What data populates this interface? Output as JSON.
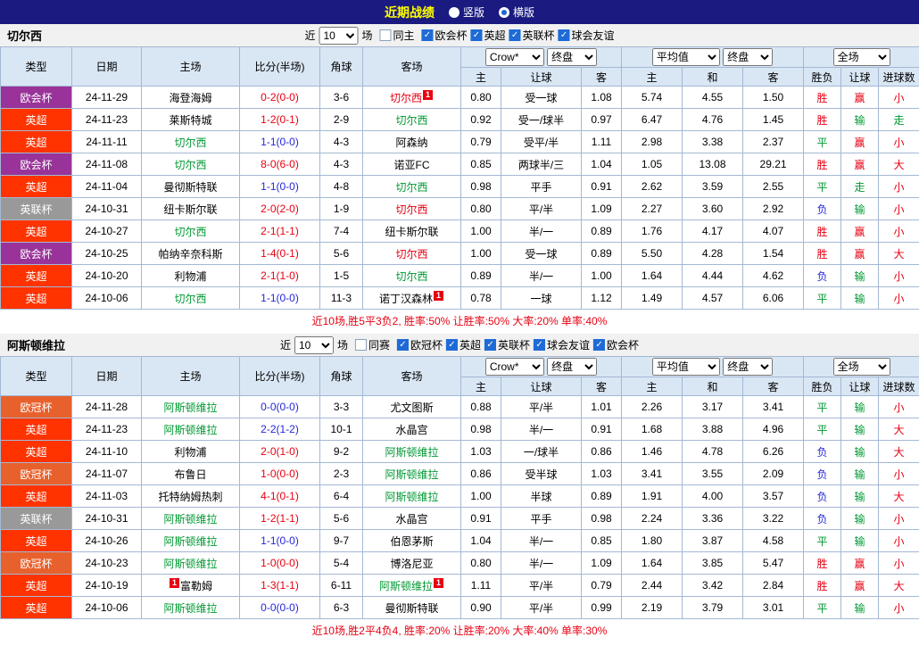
{
  "topbar": {
    "title": "近期战绩",
    "options": [
      {
        "label": "竖版",
        "selected": false
      },
      {
        "label": "横版",
        "selected": true
      }
    ]
  },
  "table_header": {
    "type": "类型",
    "date": "日期",
    "home": "主场",
    "score": "比分(半场)",
    "corner": "角球",
    "away": "客场",
    "odds_source": "Crow*",
    "stage": "终盘",
    "average": "平均值",
    "fulltime": "全场",
    "home_short": "主",
    "away_short": "客",
    "draw_short": "和",
    "handicap": "让球",
    "result": "胜负",
    "goals": "进球数"
  },
  "sections": [
    {
      "title": "切尔西",
      "filter": {
        "near_label": "近",
        "count": "10",
        "games_label": "场",
        "same_label": "同主",
        "same_checked": false,
        "competitions": [
          {
            "label": "欧会杯",
            "checked": true
          },
          {
            "label": "英超",
            "checked": true
          },
          {
            "label": "英联杯",
            "checked": true
          },
          {
            "label": "球会友谊",
            "checked": true
          }
        ]
      },
      "rows": [
        {
          "type": "欧会杯",
          "type_color": "#993399",
          "date": "24-11-29",
          "home": "海登海姆",
          "home_color": "#000000",
          "home_card": "",
          "score": "0-2(0-0)",
          "score_color": "#e60012",
          "corner": "3-6",
          "away": "切尔西",
          "away_color": "#e60012",
          "away_card": "1",
          "odds": [
            "0.80",
            "受一球",
            "1.08"
          ],
          "avg": [
            "5.74",
            "4.55",
            "1.50"
          ],
          "result": {
            "text": "胜",
            "color": "#e60012"
          },
          "handicap": {
            "text": "赢",
            "color": "#e60012"
          },
          "goals": {
            "text": "小",
            "color": "#e60012"
          }
        },
        {
          "type": "英超",
          "type_color": "#ff3300",
          "date": "24-11-23",
          "home": "莱斯特城",
          "home_color": "#000000",
          "home_card": "",
          "score": "1-2(0-1)",
          "score_color": "#e60012",
          "corner": "2-9",
          "away": "切尔西",
          "away_color": "#009933",
          "away_card": "",
          "odds": [
            "0.92",
            "受一/球半",
            "0.97"
          ],
          "avg": [
            "6.47",
            "4.76",
            "1.45"
          ],
          "result": {
            "text": "胜",
            "color": "#e60012"
          },
          "handicap": {
            "text": "输",
            "color": "#009933"
          },
          "goals": {
            "text": "走",
            "color": "#009933"
          }
        },
        {
          "type": "英超",
          "type_color": "#ff3300",
          "date": "24-11-11",
          "home": "切尔西",
          "home_color": "#009933",
          "home_card": "",
          "score": "1-1(0-0)",
          "score_color": "#2626d9",
          "corner": "4-3",
          "away": "阿森纳",
          "away_color": "#000000",
          "away_card": "",
          "odds": [
            "0.79",
            "受平/半",
            "1.11"
          ],
          "avg": [
            "2.98",
            "3.38",
            "2.37"
          ],
          "result": {
            "text": "平",
            "color": "#009933"
          },
          "handicap": {
            "text": "赢",
            "color": "#e60012"
          },
          "goals": {
            "text": "小",
            "color": "#e60012"
          }
        },
        {
          "type": "欧会杯",
          "type_color": "#993399",
          "date": "24-11-08",
          "home": "切尔西",
          "home_color": "#009933",
          "home_card": "",
          "score": "8-0(6-0)",
          "score_color": "#e60012",
          "corner": "4-3",
          "away": "诺亚FC",
          "away_color": "#000000",
          "away_card": "",
          "odds": [
            "0.85",
            "两球半/三",
            "1.04"
          ],
          "avg": [
            "1.05",
            "13.08",
            "29.21"
          ],
          "result": {
            "text": "胜",
            "color": "#e60012"
          },
          "handicap": {
            "text": "赢",
            "color": "#e60012"
          },
          "goals": {
            "text": "大",
            "color": "#e60012"
          }
        },
        {
          "type": "英超",
          "type_color": "#ff3300",
          "date": "24-11-04",
          "home": "曼彻斯特联",
          "home_color": "#000000",
          "home_card": "",
          "score": "1-1(0-0)",
          "score_color": "#2626d9",
          "corner": "4-8",
          "away": "切尔西",
          "away_color": "#009933",
          "away_card": "",
          "odds": [
            "0.98",
            "平手",
            "0.91"
          ],
          "avg": [
            "2.62",
            "3.59",
            "2.55"
          ],
          "result": {
            "text": "平",
            "color": "#009933"
          },
          "handicap": {
            "text": "走",
            "color": "#009933"
          },
          "goals": {
            "text": "小",
            "color": "#e60012"
          }
        },
        {
          "type": "英联杯",
          "type_color": "#999999",
          "date": "24-10-31",
          "home": "纽卡斯尔联",
          "home_color": "#000000",
          "home_card": "",
          "score": "2-0(2-0)",
          "score_color": "#e60012",
          "corner": "1-9",
          "away": "切尔西",
          "away_color": "#e60012",
          "away_card": "",
          "odds": [
            "0.80",
            "平/半",
            "1.09"
          ],
          "avg": [
            "2.27",
            "3.60",
            "2.92"
          ],
          "result": {
            "text": "负",
            "color": "#2626d9"
          },
          "handicap": {
            "text": "输",
            "color": "#009933"
          },
          "goals": {
            "text": "小",
            "color": "#e60012"
          }
        },
        {
          "type": "英超",
          "type_color": "#ff3300",
          "date": "24-10-27",
          "home": "切尔西",
          "home_color": "#009933",
          "home_card": "",
          "score": "2-1(1-1)",
          "score_color": "#e60012",
          "corner": "7-4",
          "away": "纽卡斯尔联",
          "away_color": "#000000",
          "away_card": "",
          "odds": [
            "1.00",
            "半/一",
            "0.89"
          ],
          "avg": [
            "1.76",
            "4.17",
            "4.07"
          ],
          "result": {
            "text": "胜",
            "color": "#e60012"
          },
          "handicap": {
            "text": "赢",
            "color": "#e60012"
          },
          "goals": {
            "text": "小",
            "color": "#e60012"
          }
        },
        {
          "type": "欧会杯",
          "type_color": "#993399",
          "date": "24-10-25",
          "home": "帕纳辛奈科斯",
          "home_color": "#000000",
          "home_card": "",
          "score": "1-4(0-1)",
          "score_color": "#e60012",
          "corner": "5-6",
          "away": "切尔西",
          "away_color": "#e60012",
          "away_card": "",
          "odds": [
            "1.00",
            "受一球",
            "0.89"
          ],
          "avg": [
            "5.50",
            "4.28",
            "1.54"
          ],
          "result": {
            "text": "胜",
            "color": "#e60012"
          },
          "handicap": {
            "text": "赢",
            "color": "#e60012"
          },
          "goals": {
            "text": "大",
            "color": "#e60012"
          }
        },
        {
          "type": "英超",
          "type_color": "#ff3300",
          "date": "24-10-20",
          "home": "利物浦",
          "home_color": "#000000",
          "home_card": "",
          "score": "2-1(1-0)",
          "score_color": "#e60012",
          "corner": "1-5",
          "away": "切尔西",
          "away_color": "#009933",
          "away_card": "",
          "odds": [
            "0.89",
            "半/一",
            "1.00"
          ],
          "avg": [
            "1.64",
            "4.44",
            "4.62"
          ],
          "result": {
            "text": "负",
            "color": "#2626d9"
          },
          "handicap": {
            "text": "输",
            "color": "#009933"
          },
          "goals": {
            "text": "小",
            "color": "#e60012"
          }
        },
        {
          "type": "英超",
          "type_color": "#ff3300",
          "date": "24-10-06",
          "home": "切尔西",
          "home_color": "#009933",
          "home_card": "",
          "score": "1-1(0-0)",
          "score_color": "#2626d9",
          "corner": "11-3",
          "away": "诺丁汉森林",
          "away_color": "#000000",
          "away_card": "1",
          "odds": [
            "0.78",
            "一球",
            "1.12"
          ],
          "avg": [
            "1.49",
            "4.57",
            "6.06"
          ],
          "result": {
            "text": "平",
            "color": "#009933"
          },
          "handicap": {
            "text": "输",
            "color": "#009933"
          },
          "goals": {
            "text": "小",
            "color": "#e60012"
          }
        }
      ],
      "summary": "近10场,胜5平3负2, 胜率:50% 让胜率:50% 大率:20% 单率:40%"
    },
    {
      "title": "阿斯顿维拉",
      "filter": {
        "near_label": "近",
        "count": "10",
        "games_label": "场",
        "same_label": "同赛",
        "same_checked": false,
        "competitions": [
          {
            "label": "欧冠杯",
            "checked": true
          },
          {
            "label": "英超",
            "checked": true
          },
          {
            "label": "英联杯",
            "checked": true
          },
          {
            "label": "球会友谊",
            "checked": true
          },
          {
            "label": "欧会杯",
            "checked": true
          }
        ]
      },
      "rows": [
        {
          "type": "欧冠杯",
          "type_color": "#e8612c",
          "date": "24-11-28",
          "home": "阿斯顿维拉",
          "home_color": "#009933",
          "home_card": "",
          "score": "0-0(0-0)",
          "score_color": "#2626d9",
          "corner": "3-3",
          "away": "尤文图斯",
          "away_color": "#000000",
          "away_card": "",
          "odds": [
            "0.88",
            "平/半",
            "1.01"
          ],
          "avg": [
            "2.26",
            "3.17",
            "3.41"
          ],
          "result": {
            "text": "平",
            "color": "#009933"
          },
          "handicap": {
            "text": "输",
            "color": "#009933"
          },
          "goals": {
            "text": "小",
            "color": "#e60012"
          }
        },
        {
          "type": "英超",
          "type_color": "#ff3300",
          "date": "24-11-23",
          "home": "阿斯顿维拉",
          "home_color": "#009933",
          "home_card": "",
          "score": "2-2(1-2)",
          "score_color": "#2626d9",
          "corner": "10-1",
          "away": "水晶宫",
          "away_color": "#000000",
          "away_card": "",
          "odds": [
            "0.98",
            "半/一",
            "0.91"
          ],
          "avg": [
            "1.68",
            "3.88",
            "4.96"
          ],
          "result": {
            "text": "平",
            "color": "#009933"
          },
          "handicap": {
            "text": "输",
            "color": "#009933"
          },
          "goals": {
            "text": "大",
            "color": "#e60012"
          }
        },
        {
          "type": "英超",
          "type_color": "#ff3300",
          "date": "24-11-10",
          "home": "利物浦",
          "home_color": "#000000",
          "home_card": "",
          "score": "2-0(1-0)",
          "score_color": "#e60012",
          "corner": "9-2",
          "away": "阿斯顿维拉",
          "away_color": "#009933",
          "away_card": "",
          "odds": [
            "1.03",
            "一/球半",
            "0.86"
          ],
          "avg": [
            "1.46",
            "4.78",
            "6.26"
          ],
          "result": {
            "text": "负",
            "color": "#2626d9"
          },
          "handicap": {
            "text": "输",
            "color": "#009933"
          },
          "goals": {
            "text": "大",
            "color": "#e60012"
          }
        },
        {
          "type": "欧冠杯",
          "type_color": "#e8612c",
          "date": "24-11-07",
          "home": "布鲁日",
          "home_color": "#000000",
          "home_card": "",
          "score": "1-0(0-0)",
          "score_color": "#e60012",
          "corner": "2-3",
          "away": "阿斯顿维拉",
          "away_color": "#009933",
          "away_card": "",
          "odds": [
            "0.86",
            "受半球",
            "1.03"
          ],
          "avg": [
            "3.41",
            "3.55",
            "2.09"
          ],
          "result": {
            "text": "负",
            "color": "#2626d9"
          },
          "handicap": {
            "text": "输",
            "color": "#009933"
          },
          "goals": {
            "text": "小",
            "color": "#e60012"
          }
        },
        {
          "type": "英超",
          "type_color": "#ff3300",
          "date": "24-11-03",
          "home": "托特纳姆热刺",
          "home_color": "#000000",
          "home_card": "",
          "score": "4-1(0-1)",
          "score_color": "#e60012",
          "corner": "6-4",
          "away": "阿斯顿维拉",
          "away_color": "#009933",
          "away_card": "",
          "odds": [
            "1.00",
            "半球",
            "0.89"
          ],
          "avg": [
            "1.91",
            "4.00",
            "3.57"
          ],
          "result": {
            "text": "负",
            "color": "#2626d9"
          },
          "handicap": {
            "text": "输",
            "color": "#009933"
          },
          "goals": {
            "text": "大",
            "color": "#e60012"
          }
        },
        {
          "type": "英联杯",
          "type_color": "#999999",
          "date": "24-10-31",
          "home": "阿斯顿维拉",
          "home_color": "#009933",
          "home_card": "",
          "score": "1-2(1-1)",
          "score_color": "#e60012",
          "corner": "5-6",
          "away": "水晶宫",
          "away_color": "#000000",
          "away_card": "",
          "odds": [
            "0.91",
            "平手",
            "0.98"
          ],
          "avg": [
            "2.24",
            "3.36",
            "3.22"
          ],
          "result": {
            "text": "负",
            "color": "#2626d9"
          },
          "handicap": {
            "text": "输",
            "color": "#009933"
          },
          "goals": {
            "text": "小",
            "color": "#e60012"
          }
        },
        {
          "type": "英超",
          "type_color": "#ff3300",
          "date": "24-10-26",
          "home": "阿斯顿维拉",
          "home_color": "#009933",
          "home_card": "",
          "score": "1-1(0-0)",
          "score_color": "#2626d9",
          "corner": "9-7",
          "away": "伯恩茅斯",
          "away_color": "#000000",
          "away_card": "",
          "odds": [
            "1.04",
            "半/一",
            "0.85"
          ],
          "avg": [
            "1.80",
            "3.87",
            "4.58"
          ],
          "result": {
            "text": "平",
            "color": "#009933"
          },
          "handicap": {
            "text": "输",
            "color": "#009933"
          },
          "goals": {
            "text": "小",
            "color": "#e60012"
          }
        },
        {
          "type": "欧冠杯",
          "type_color": "#e8612c",
          "date": "24-10-23",
          "home": "阿斯顿维拉",
          "home_color": "#009933",
          "home_card": "",
          "score": "1-0(0-0)",
          "score_color": "#e60012",
          "corner": "5-4",
          "away": "博洛尼亚",
          "away_color": "#000000",
          "away_card": "",
          "odds": [
            "0.80",
            "半/一",
            "1.09"
          ],
          "avg": [
            "1.64",
            "3.85",
            "5.47"
          ],
          "result": {
            "text": "胜",
            "color": "#e60012"
          },
          "handicap": {
            "text": "赢",
            "color": "#e60012"
          },
          "goals": {
            "text": "小",
            "color": "#e60012"
          }
        },
        {
          "type": "英超",
          "type_color": "#ff3300",
          "date": "24-10-19",
          "home": "富勒姆",
          "home_color": "#000000",
          "home_card": "1",
          "score": "1-3(1-1)",
          "score_color": "#e60012",
          "corner": "6-11",
          "away": "阿斯顿维拉",
          "away_color": "#009933",
          "away_card": "1",
          "odds": [
            "1.11",
            "平/半",
            "0.79"
          ],
          "avg": [
            "2.44",
            "3.42",
            "2.84"
          ],
          "result": {
            "text": "胜",
            "color": "#e60012"
          },
          "handicap": {
            "text": "赢",
            "color": "#e60012"
          },
          "goals": {
            "text": "大",
            "color": "#e60012"
          }
        },
        {
          "type": "英超",
          "type_color": "#ff3300",
          "date": "24-10-06",
          "home": "阿斯顿维拉",
          "home_color": "#009933",
          "home_card": "",
          "score": "0-0(0-0)",
          "score_color": "#2626d9",
          "corner": "6-3",
          "away": "曼彻斯特联",
          "away_color": "#000000",
          "away_card": "",
          "odds": [
            "0.90",
            "平/半",
            "0.99"
          ],
          "avg": [
            "2.19",
            "3.79",
            "3.01"
          ],
          "result": {
            "text": "平",
            "color": "#009933"
          },
          "handicap": {
            "text": "输",
            "color": "#009933"
          },
          "goals": {
            "text": "小",
            "color": "#e60012"
          }
        }
      ],
      "summary": "近10场,胜2平4负4, 胜率:20% 让胜率:20% 大率:40% 单率:30%"
    }
  ]
}
